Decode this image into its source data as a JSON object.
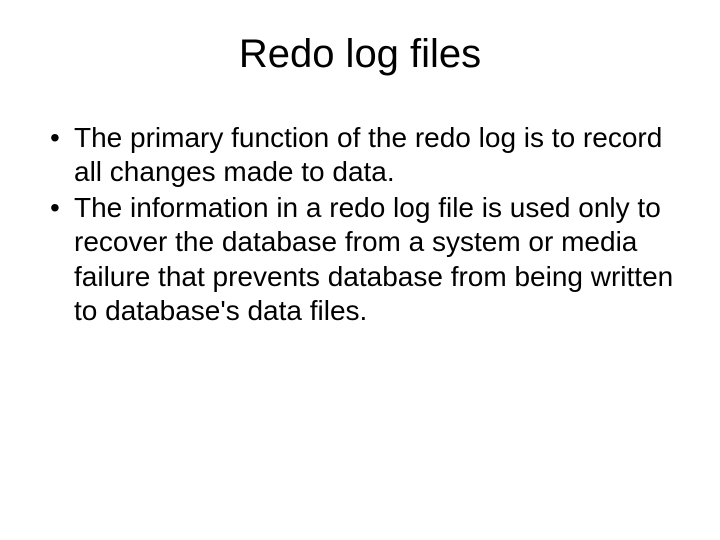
{
  "slide": {
    "title": "Redo log files",
    "bullets": [
      "The primary function of the redo log is to record all changes made to data.",
      "The information in a redo log file is used only to recover the database from a system or media failure that prevents database from being written to database's data files."
    ]
  }
}
